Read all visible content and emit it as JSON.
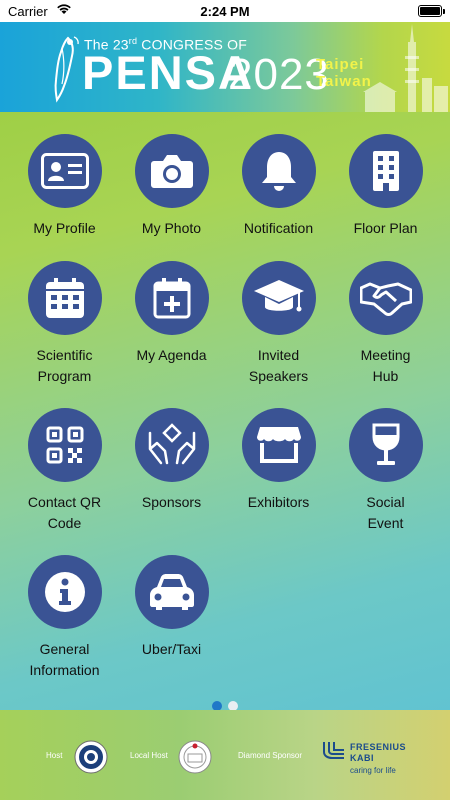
{
  "status_bar": {
    "carrier": "Carrier",
    "time": "2:24 PM"
  },
  "banner": {
    "prefix": "The 23",
    "ordinal": "rd",
    "suffix": " CONGRESS OF",
    "title": "PENSA",
    "year": "2023",
    "city": "Taipei",
    "country": "Taiwan"
  },
  "menu": {
    "my_profile": "My Profile",
    "my_photo": "My Photo",
    "notification": "Notification",
    "floor_plan": "Floor Plan",
    "scientific_program_l1": "Scientific",
    "scientific_program_l2": "Program",
    "my_agenda": "My Agenda",
    "invited_speakers_l1": "Invited",
    "invited_speakers_l2": "Speakers",
    "meeting_hub_l1": "Meeting",
    "meeting_hub_l2": "Hub",
    "contact_qr_l1": "Contact QR",
    "contact_qr_l2": "Code",
    "sponsors": "Sponsors",
    "exhibitors": "Exhibitors",
    "social_event_l1": "Social",
    "social_event_l2": "Event",
    "general_info_l1": "General",
    "general_info_l2": "Information",
    "uber_taxi": "Uber/Taxi"
  },
  "pagination": {
    "current_page": 1,
    "total_pages": 2
  },
  "footer": {
    "host_label": "Host",
    "local_host_label": "Local Host",
    "diamond_sponsor_label": "Diamond Sponsor",
    "sponsor_name_l1": "FRESENIUS",
    "sponsor_name_l2": "KABI",
    "sponsor_tagline": "caring for life"
  },
  "colors": {
    "icon_circle": "#3a5394",
    "active_dot": "#1f78c8",
    "sponsor_blue": "#1b4c8c",
    "city_yellow": "#f2f34a"
  }
}
